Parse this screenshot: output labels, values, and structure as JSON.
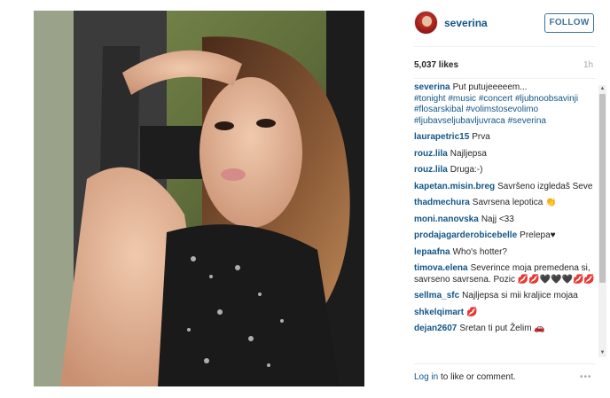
{
  "post": {
    "photo_alt": "Photo",
    "account": {
      "username": "severina",
      "follow_label": "FOLLOW"
    },
    "likes": "5,037 likes",
    "time_ago": "1h",
    "caption": {
      "author": "severina",
      "text": "Put putujeeeeem...",
      "tags": "#tonight #music #concert #ljubnoobsavinji #flosarskibal #volimstosevolimo #ljubavseljubavljuvraca #severina"
    },
    "comments": [
      {
        "author": "laurapetric15",
        "text": "Prva"
      },
      {
        "author": "rouz.lila",
        "text": "Najljepsa"
      },
      {
        "author": "rouz.lila",
        "text": "Druga:-)"
      },
      {
        "author": "kapetan.misin.breg",
        "text": "Savršeno izgledaš Seve"
      },
      {
        "author": "thadmechura",
        "text": "Savrsena lepotica 👏"
      },
      {
        "author": "moni.nanovska",
        "text": "Najj <33"
      },
      {
        "author": "prodajagarderobicebelle",
        "text": "Prelepa♥"
      },
      {
        "author": "lepaafna",
        "text": "Who's hotter?"
      },
      {
        "author": "timova.elena",
        "text": "Severince moja premedena si, savrseno savrsena. Pozic 💋💋🖤🖤🖤💋💋"
      },
      {
        "author": "sellma_sfc",
        "text": "Najljepsa si mii kraljice mojaa"
      },
      {
        "author": "shkelqimart",
        "text": "💋"
      },
      {
        "author": "dejan2607",
        "text": "Sretan ti put Želim 🚗"
      }
    ],
    "footer": {
      "login_link": "Log in",
      "login_suffix": " to like or comment.",
      "more_icon": "•••"
    }
  }
}
